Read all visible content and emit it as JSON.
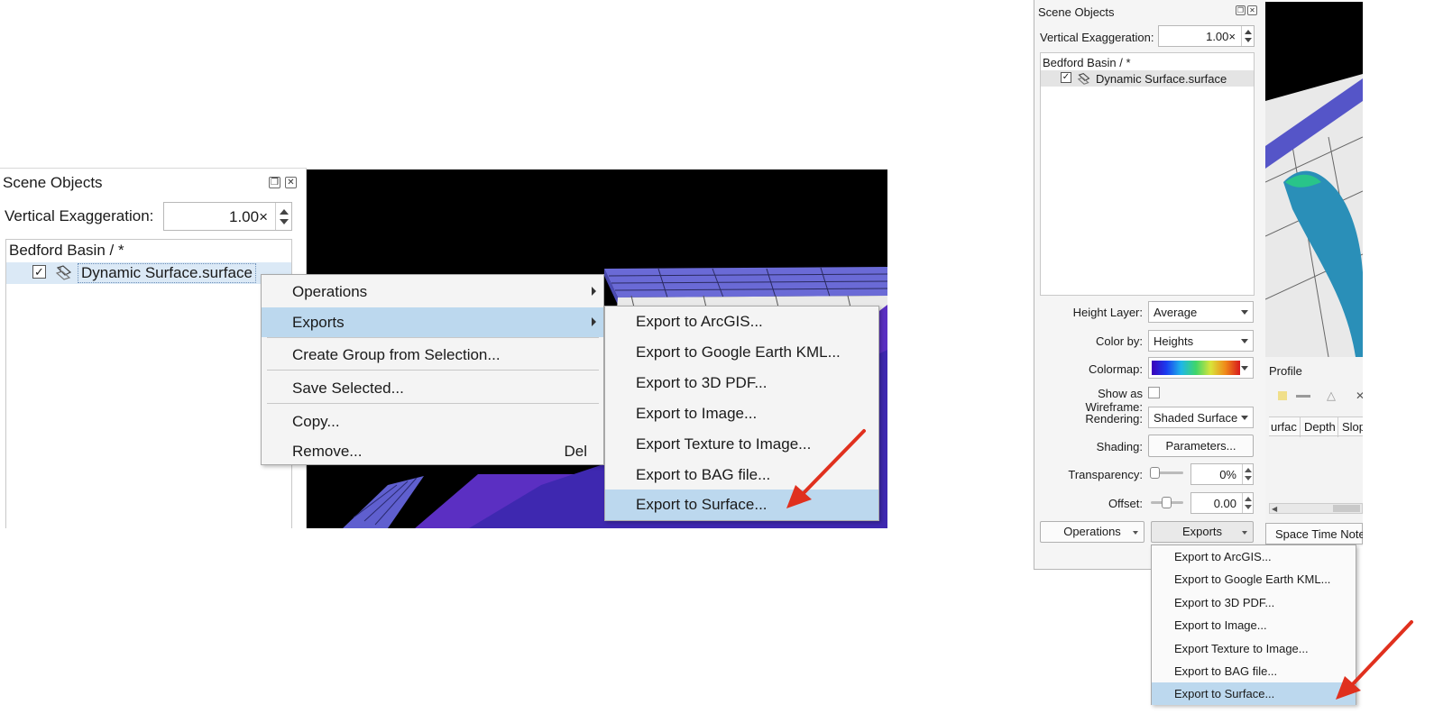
{
  "left_panel": {
    "title": "Scene Objects",
    "vertical_exaggeration_label": "Vertical Exaggeration:",
    "vertical_exaggeration_value": "1.00×",
    "tree_root": "Bedford Basin / *",
    "tree_item": "Dynamic Surface.surface",
    "tree_item_checked": true,
    "context_menu": {
      "items": [
        {
          "label": "Operations",
          "submenu": true
        },
        {
          "label": "Exports",
          "submenu": true,
          "highlighted": true
        },
        {
          "label": "Create Group from Selection..."
        },
        {
          "label": "Save Selected..."
        },
        {
          "label": "Copy..."
        },
        {
          "label": "Remove...",
          "shortcut": "Del"
        }
      ]
    },
    "exports_submenu": {
      "items": [
        "Export to ArcGIS...",
        "Export to Google Earth KML...",
        "Export to 3D PDF...",
        "Export to Image...",
        "Export Texture to Image...",
        "Export to BAG file...",
        "Export to Surface..."
      ],
      "highlighted_index": 6
    }
  },
  "right_panel": {
    "title": "Scene Objects",
    "vertical_exaggeration_label": "Vertical Exaggeration:",
    "vertical_exaggeration_value": "1.00×",
    "tree_root": "Bedford Basin / *",
    "tree_item": "Dynamic Surface.surface",
    "height_layer_label": "Height Layer:",
    "height_layer_value": "Average",
    "color_by_label": "Color by:",
    "color_by_value": "Heights",
    "colormap_label": "Colormap:",
    "wireframe_label": "Show as Wireframe:",
    "rendering_label": "Rendering:",
    "rendering_value": "Shaded Surface",
    "shading_label": "Shading:",
    "shading_button": "Parameters...",
    "transparency_label": "Transparency:",
    "transparency_value": "0%",
    "transparency_level": 0,
    "offset_label": "Offset:",
    "offset_value": "0.00",
    "offset_level": 0.5,
    "operations_button": "Operations",
    "exports_button": "Exports",
    "profile_label": "Profile",
    "profile_columns": [
      "urfac",
      "Depth",
      "Slop"
    ],
    "space_time_tab": "Space Time Note",
    "exports_dropdown": {
      "items": [
        "Export to ArcGIS...",
        "Export to Google Earth KML...",
        "Export to 3D PDF...",
        "Export to Image...",
        "Export Texture to Image...",
        "Export to BAG file...",
        "Export to Surface..."
      ],
      "highlighted_index": 6
    }
  },
  "colors": {
    "menu_highlight": "#bcd8ee",
    "arrow": "#e0301e",
    "surface_blue": "#5b5bc9"
  }
}
